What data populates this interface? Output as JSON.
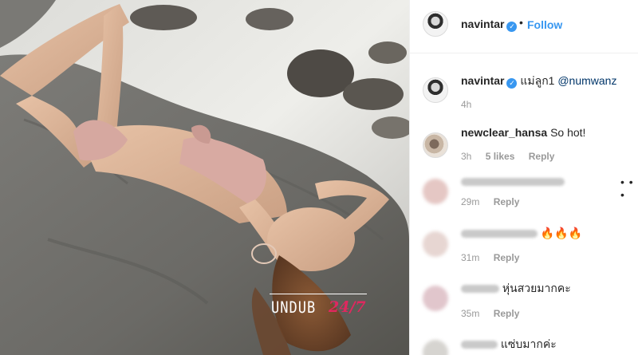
{
  "post": {
    "username": "navintar",
    "verified_mark": "✓",
    "separator": "•",
    "follow_label": "Follow"
  },
  "caption": {
    "username": "navintar",
    "text": "แม่ลูก1",
    "mention": "@numwanz",
    "time": "4h"
  },
  "comments": [
    {
      "username": "newclear_hansa",
      "text": "So hot!",
      "time": "3h",
      "likes": "5 likes",
      "reply": "Reply"
    },
    {
      "username": "",
      "text": "",
      "time": "29m",
      "reply": "Reply"
    },
    {
      "username": "",
      "text": "🔥🔥🔥",
      "time": "31m",
      "reply": "Reply"
    },
    {
      "username": "",
      "text": "หุ่นสวยมากคะ",
      "time": "35m",
      "reply": "Reply"
    },
    {
      "username": "",
      "text": "แซ่บมากค่ะ",
      "time": "",
      "reply": ""
    }
  ],
  "more_options": "• • •",
  "watermark": {
    "text": "UNDUB",
    "accent": "24/7"
  },
  "colors": {
    "link_blue": "#3897f0",
    "mention_blue": "#003569",
    "meta_gray": "#999999",
    "watermark_accent": "#e0285f"
  },
  "icons": {
    "verified": "verified-badge-icon",
    "more": "more-options-icon"
  }
}
